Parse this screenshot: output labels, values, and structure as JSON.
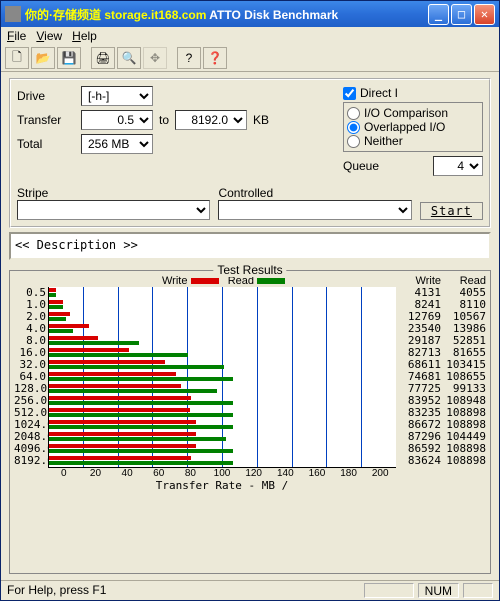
{
  "watermark": "你的·存储频道 storage.it168.com",
  "window": {
    "title": "ATTO Disk Benchmark"
  },
  "menubar": {
    "file": "File",
    "view": "View",
    "help": "Help"
  },
  "settings": {
    "drive_label": "Drive",
    "drive_value": "[-h-]",
    "transfer_label": "Transfer",
    "transfer_from": "0.5",
    "to_label": "to",
    "transfer_to": "8192.0",
    "transfer_unit": "KB",
    "total_label": "Total",
    "total_value": "256 MB",
    "direct_io_label": "Direct I",
    "direct_io_checked": true,
    "mode": {
      "io_comp": "I/O Comparison",
      "overlapped": "Overlapped I/O",
      "neither": "Neither",
      "selected": "overlapped"
    },
    "queue_label": "Queue",
    "queue_value": "4",
    "stripe_label": "Stripe",
    "stripe_value": "",
    "controlled_label": "Controlled",
    "controlled_value": "",
    "start_label": "Start"
  },
  "description": "<< Description >>",
  "results": {
    "title": "Test Results",
    "write_legend": "Write",
    "read_legend": "Read",
    "col_write": "Write",
    "col_read": "Read",
    "xlabel": "Transfer Rate - MB /"
  },
  "statusbar": {
    "help": "For Help, press F1",
    "num": "NUM"
  },
  "chart_data": {
    "type": "bar",
    "xlabel": "Transfer Rate - MB /",
    "xlim": [
      0,
      200
    ],
    "xticks": [
      0,
      20,
      40,
      60,
      80,
      100,
      120,
      140,
      160,
      180,
      200
    ],
    "series": [
      {
        "name": "Write",
        "color": "#d80000"
      },
      {
        "name": "Read",
        "color": "#008000"
      }
    ],
    "rows": [
      {
        "size": "0.5",
        "write_kb": 4131,
        "read_kb": 4055,
        "write_mb": 4,
        "read_mb": 4
      },
      {
        "size": "1.0",
        "write_kb": 8241,
        "read_kb": 8110,
        "write_mb": 8,
        "read_mb": 8
      },
      {
        "size": "2.0",
        "write_kb": 12769,
        "read_kb": 10567,
        "write_mb": 12,
        "read_mb": 10
      },
      {
        "size": "4.0",
        "write_kb": 23540,
        "read_kb": 13986,
        "write_mb": 23,
        "read_mb": 14
      },
      {
        "size": "8.0",
        "write_kb": 29187,
        "read_kb": 52851,
        "write_mb": 28,
        "read_mb": 52
      },
      {
        "size": "16.0",
        "write_kb": 82713,
        "read_kb": 81655,
        "write_mb": 46,
        "read_mb": 80
      },
      {
        "size": "32.0",
        "write_kb": 68611,
        "read_kb": 103415,
        "write_mb": 67,
        "read_mb": 101
      },
      {
        "size": "64.0",
        "write_kb": 74681,
        "read_kb": 108655,
        "write_mb": 73,
        "read_mb": 106
      },
      {
        "size": "128.0",
        "write_kb": 77725,
        "read_kb": 99133,
        "write_mb": 76,
        "read_mb": 97
      },
      {
        "size": "256.0",
        "write_kb": 83952,
        "read_kb": 108948,
        "write_mb": 82,
        "read_mb": 106
      },
      {
        "size": "512.0",
        "write_kb": 83235,
        "read_kb": 108898,
        "write_mb": 81,
        "read_mb": 106
      },
      {
        "size": "1024.0",
        "write_kb": 86672,
        "read_kb": 108898,
        "write_mb": 85,
        "read_mb": 106
      },
      {
        "size": "2048.0",
        "write_kb": 87296,
        "read_kb": 104449,
        "write_mb": 85,
        "read_mb": 102
      },
      {
        "size": "4096.0",
        "write_kb": 86592,
        "read_kb": 108898,
        "write_mb": 85,
        "read_mb": 106
      },
      {
        "size": "8192.0",
        "write_kb": 83624,
        "read_kb": 108898,
        "write_mb": 82,
        "read_mb": 106
      }
    ]
  }
}
